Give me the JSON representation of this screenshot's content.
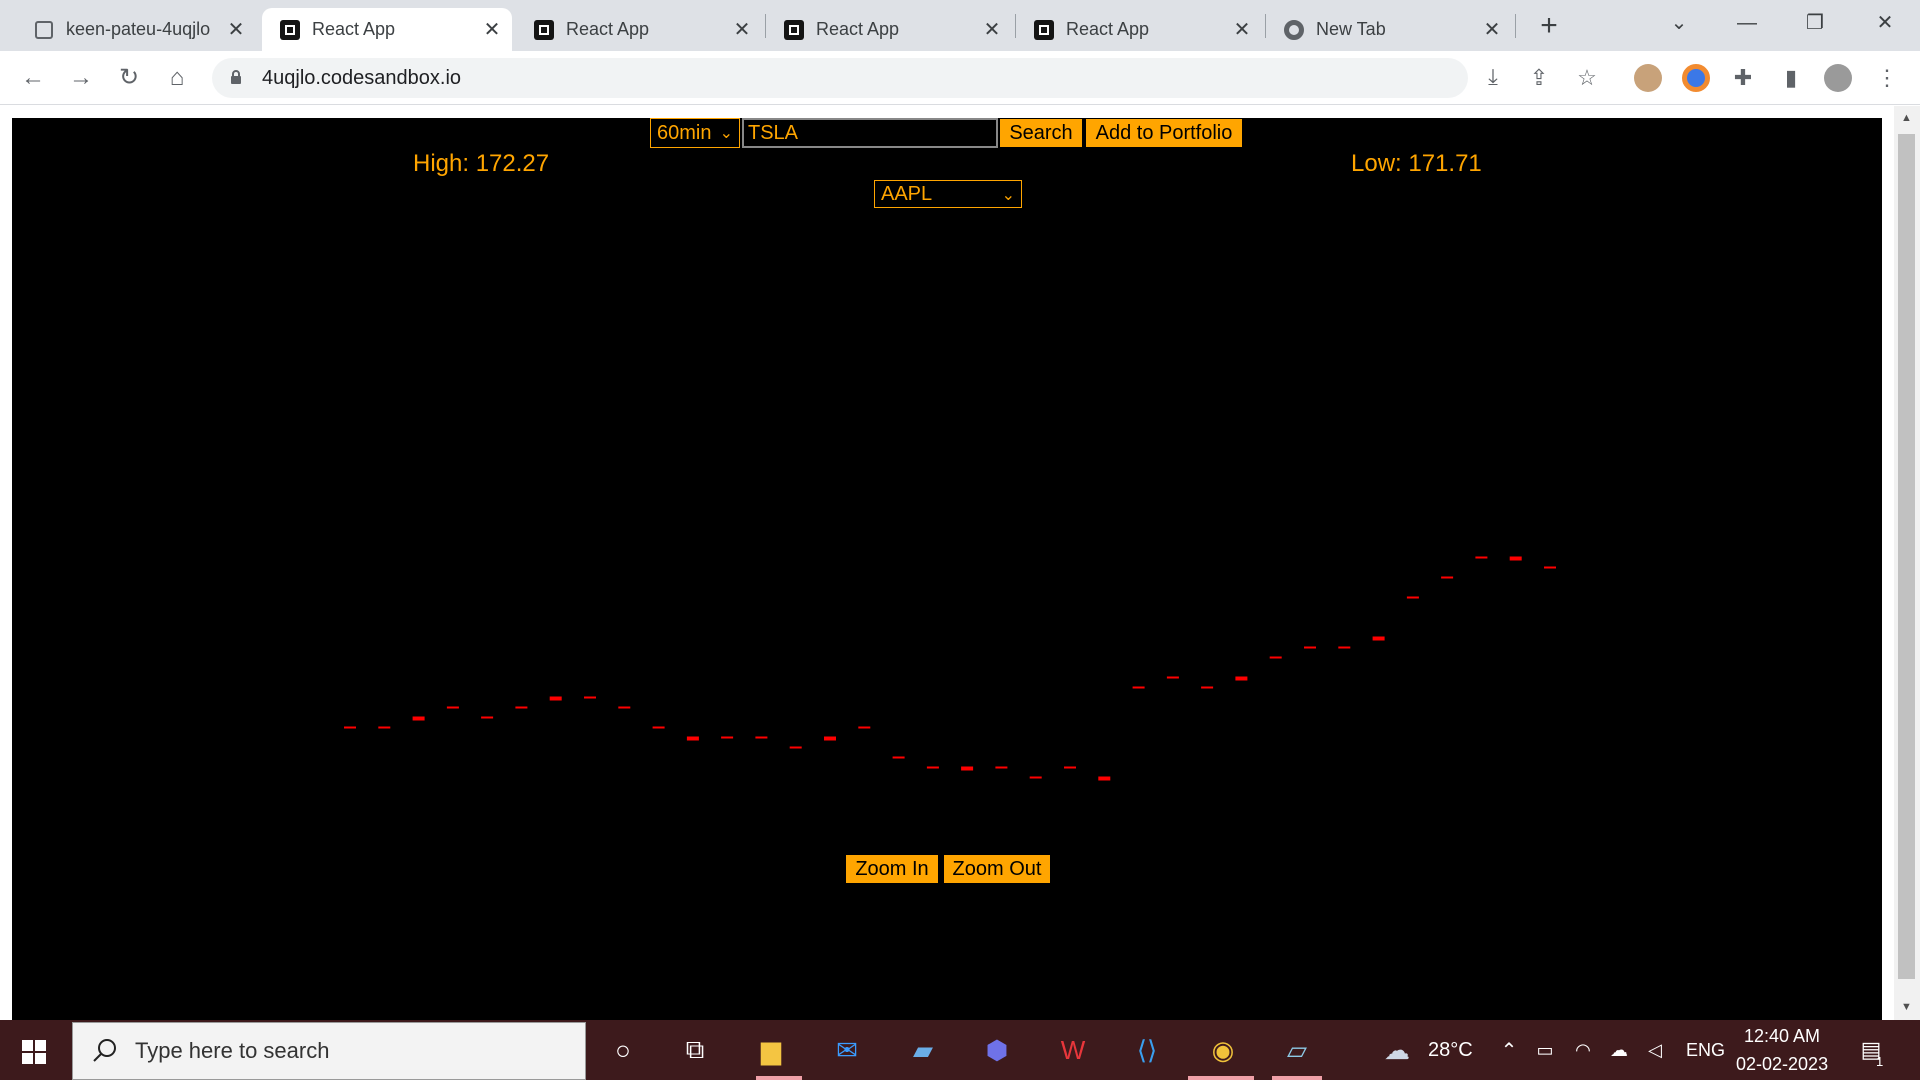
{
  "browser": {
    "tabs": [
      {
        "title": "keen-pateu-4uqjlo",
        "active": false,
        "favicon": "codesandbox-outline-icon"
      },
      {
        "title": "React App",
        "active": true,
        "favicon": "codesandbox-icon"
      },
      {
        "title": "React App",
        "active": false,
        "favicon": "codesandbox-icon"
      },
      {
        "title": "React App",
        "active": false,
        "favicon": "codesandbox-icon"
      },
      {
        "title": "React App",
        "active": false,
        "favicon": "codesandbox-icon"
      },
      {
        "title": "New Tab",
        "active": false,
        "favicon": "chrome-icon"
      }
    ],
    "url": "4uqjlo.codesandbox.io"
  },
  "app": {
    "interval_select": "60min",
    "search_value": "TSLA",
    "search_label": "Search",
    "add_portfolio_label": "Add to Portfolio",
    "high_text": "High: 172.27",
    "low_text": "Low: 171.71",
    "portfolio_select": "AAPL",
    "zoom_in_label": "Zoom In",
    "zoom_out_label": "Zoom Out",
    "background": "#000000",
    "accent": "#ffa500",
    "candle_color": "#ff0000"
  },
  "chart_data": {
    "type": "candlestick",
    "title": "",
    "ylim": [
      171.71,
      172.27
    ],
    "series": [
      {
        "values": [
          171.78,
          171.78,
          171.79,
          171.8,
          171.79,
          171.8,
          171.81,
          171.81,
          171.8,
          171.78,
          171.77,
          171.77,
          171.77,
          171.76,
          171.77,
          171.78,
          171.75,
          171.74,
          171.74,
          171.74,
          171.73,
          171.74,
          171.73,
          171.82,
          171.83,
          171.82,
          171.83,
          171.85,
          171.86,
          171.86,
          171.87,
          171.91,
          171.93,
          171.95,
          171.95,
          171.94
        ]
      }
    ]
  },
  "taskbar": {
    "search_placeholder": "Type here to search",
    "weather": "28°C",
    "language": "ENG",
    "time": "12:40 AM",
    "date": "02-02-2023",
    "notifications": "1"
  }
}
